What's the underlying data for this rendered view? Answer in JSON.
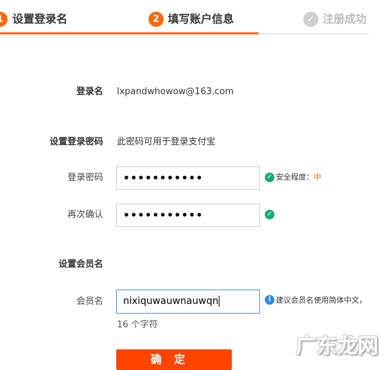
{
  "steps": [
    {
      "num": "1",
      "label": "设置登录名"
    },
    {
      "num": "2",
      "label": "填写账户信息"
    },
    {
      "num": "✓",
      "label": "注册成功"
    }
  ],
  "login": {
    "label": "登录名",
    "value": "lxpandwhowow@163.com"
  },
  "password_section": {
    "label": "设置登录密码",
    "note": "此密码可用于登录支付宝"
  },
  "password": {
    "label": "登录密码",
    "value": "•••••••••••",
    "strength_label": "安全程度：",
    "strength_value": "中"
  },
  "confirm_password": {
    "label": "再次确认",
    "value": "•••••••••••"
  },
  "member_section": {
    "label": "设置会员名"
  },
  "member": {
    "label": "会员名",
    "value": "nixiquwauwnauwqn",
    "hint": "建议会员名使用简体中文，",
    "char_count": "16 个字符"
  },
  "confirm_button": "确定",
  "watermark": "广东龙网",
  "colors": {
    "accent": "#ff6600",
    "button": "#ff4400",
    "ok": "#1aaa7a",
    "info": "#2a8af6",
    "focus": "#4d90fe"
  }
}
